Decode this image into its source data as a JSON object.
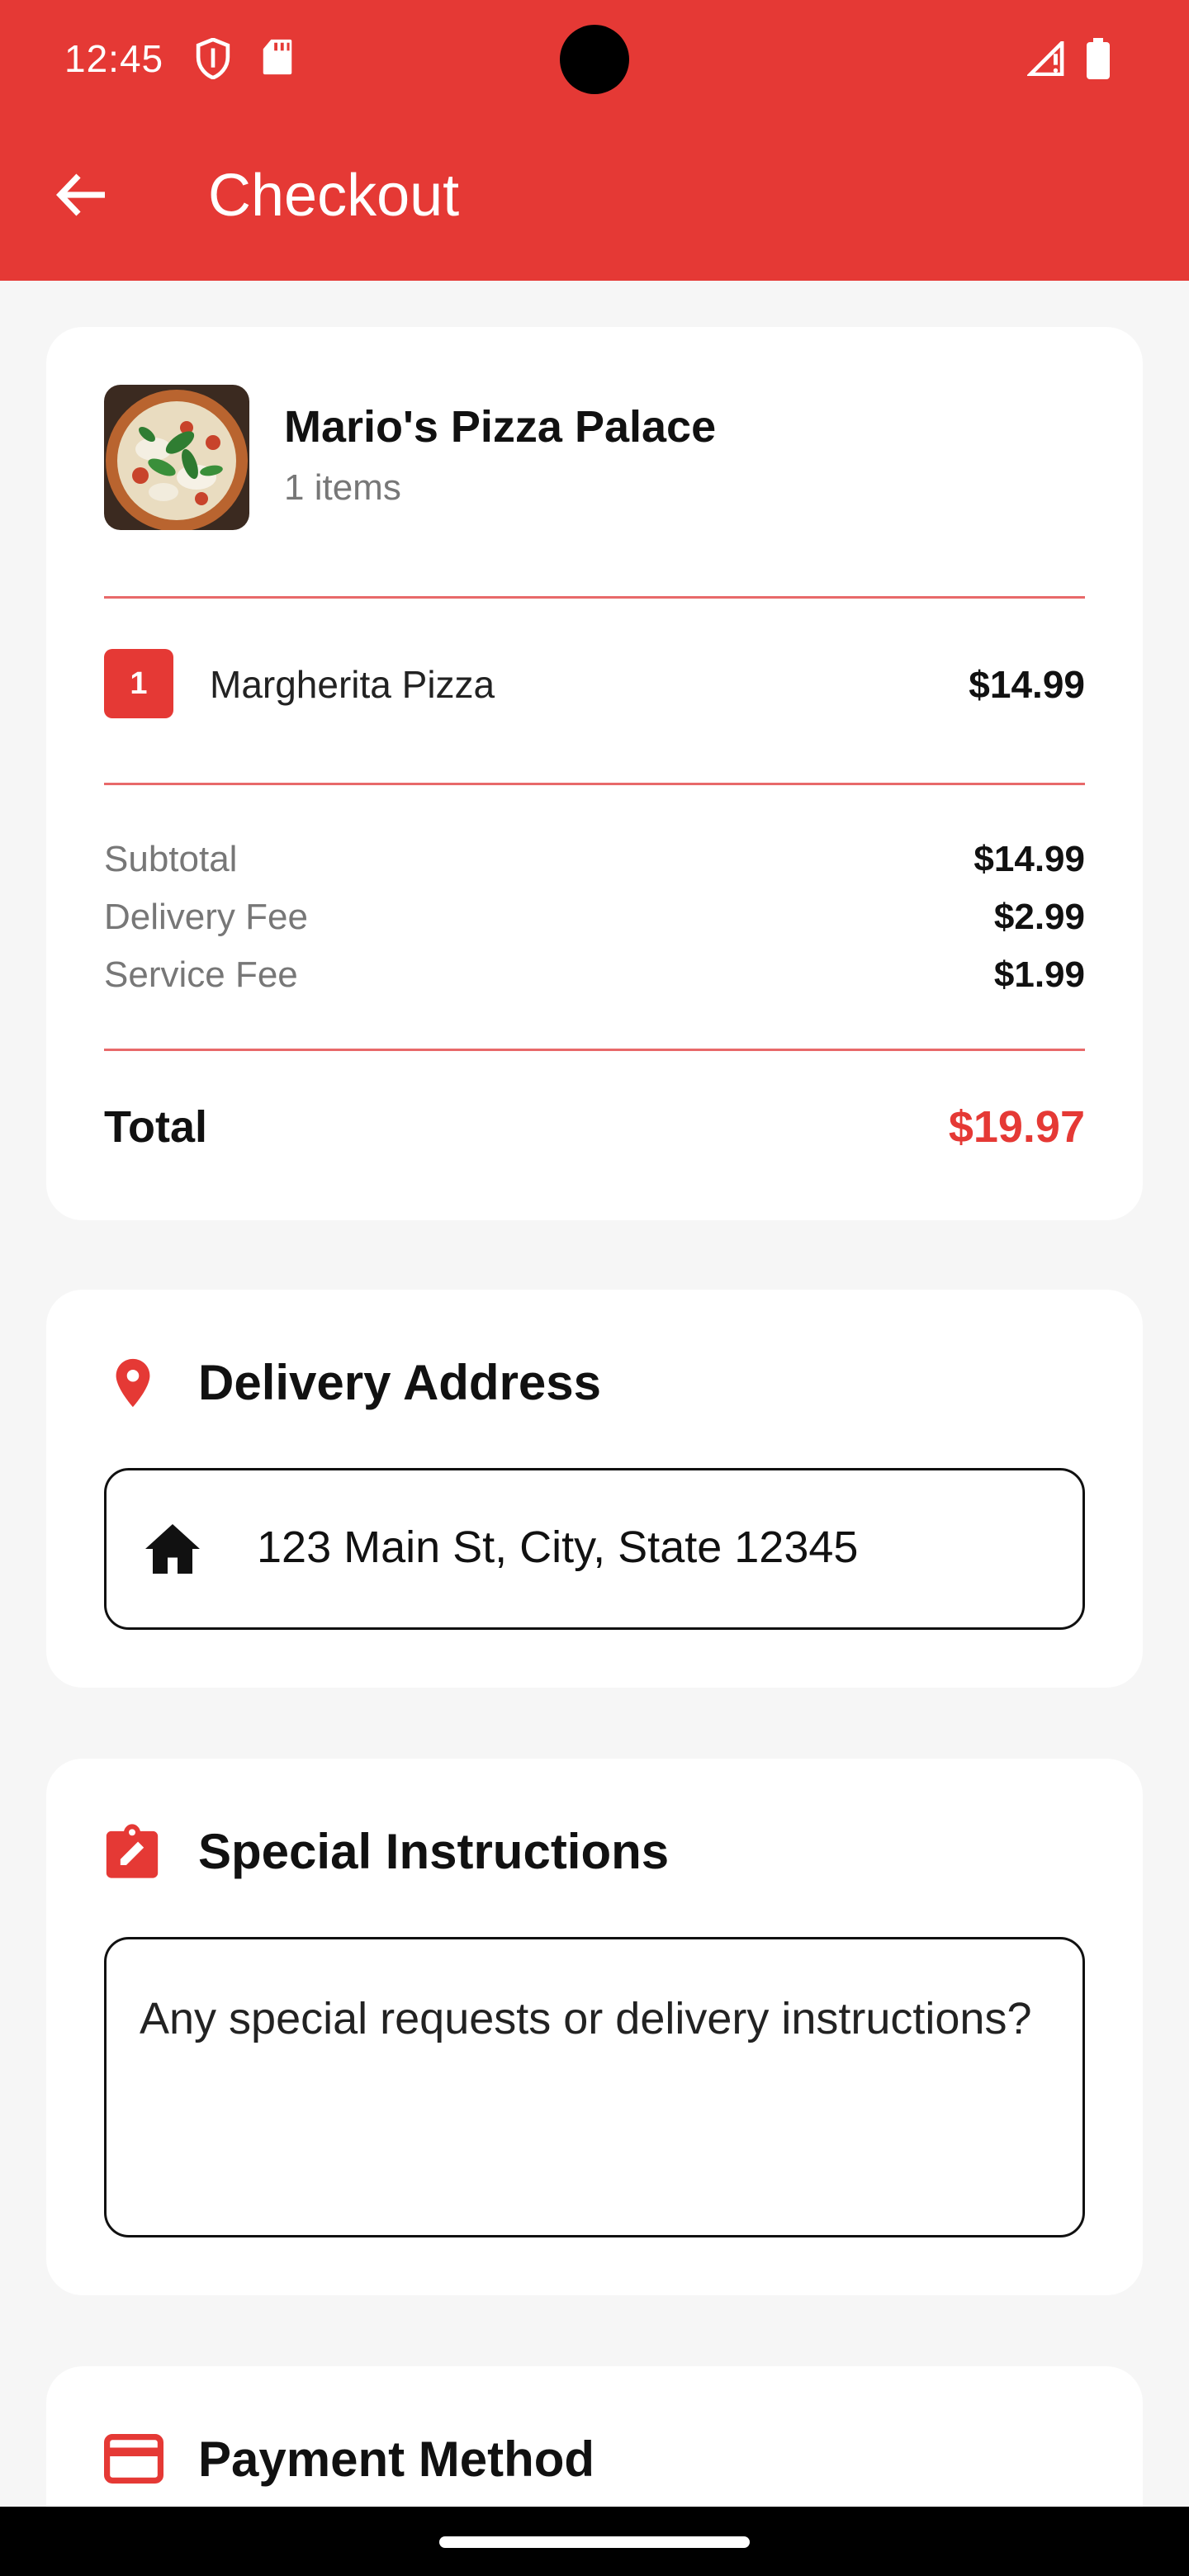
{
  "status_bar": {
    "time": "12:45",
    "icons": [
      "shield-icon",
      "sd-card-icon",
      "signal-icon",
      "battery-icon"
    ]
  },
  "app_bar": {
    "title": "Checkout",
    "back_icon": "arrow-back-icon",
    "color": "#e53935"
  },
  "order": {
    "restaurant_name": "Mario's Pizza Palace",
    "item_count": "1 items",
    "items": [
      {
        "quantity": "1",
        "name": "Margherita Pizza",
        "price": "$14.99"
      }
    ],
    "fees": [
      {
        "label": "Subtotal",
        "value": "$14.99"
      },
      {
        "label": "Delivery Fee",
        "value": "$2.99"
      },
      {
        "label": "Service Fee",
        "value": "$1.99"
      }
    ],
    "total_label": "Total",
    "total_value": "$19.97"
  },
  "delivery": {
    "title": "Delivery Address",
    "icon": "location-pin-icon",
    "address": "123 Main St, City, State 12345",
    "address_icon": "home-icon"
  },
  "instructions": {
    "title": "Special Instructions",
    "icon": "clipboard-edit-icon",
    "placeholder": "Any special requests or delivery instructions?"
  },
  "payment": {
    "title": "Payment Method",
    "icon": "credit-card-icon"
  },
  "colors": {
    "accent": "#e53935",
    "background": "#f6f6f6",
    "card": "#ffffff"
  }
}
